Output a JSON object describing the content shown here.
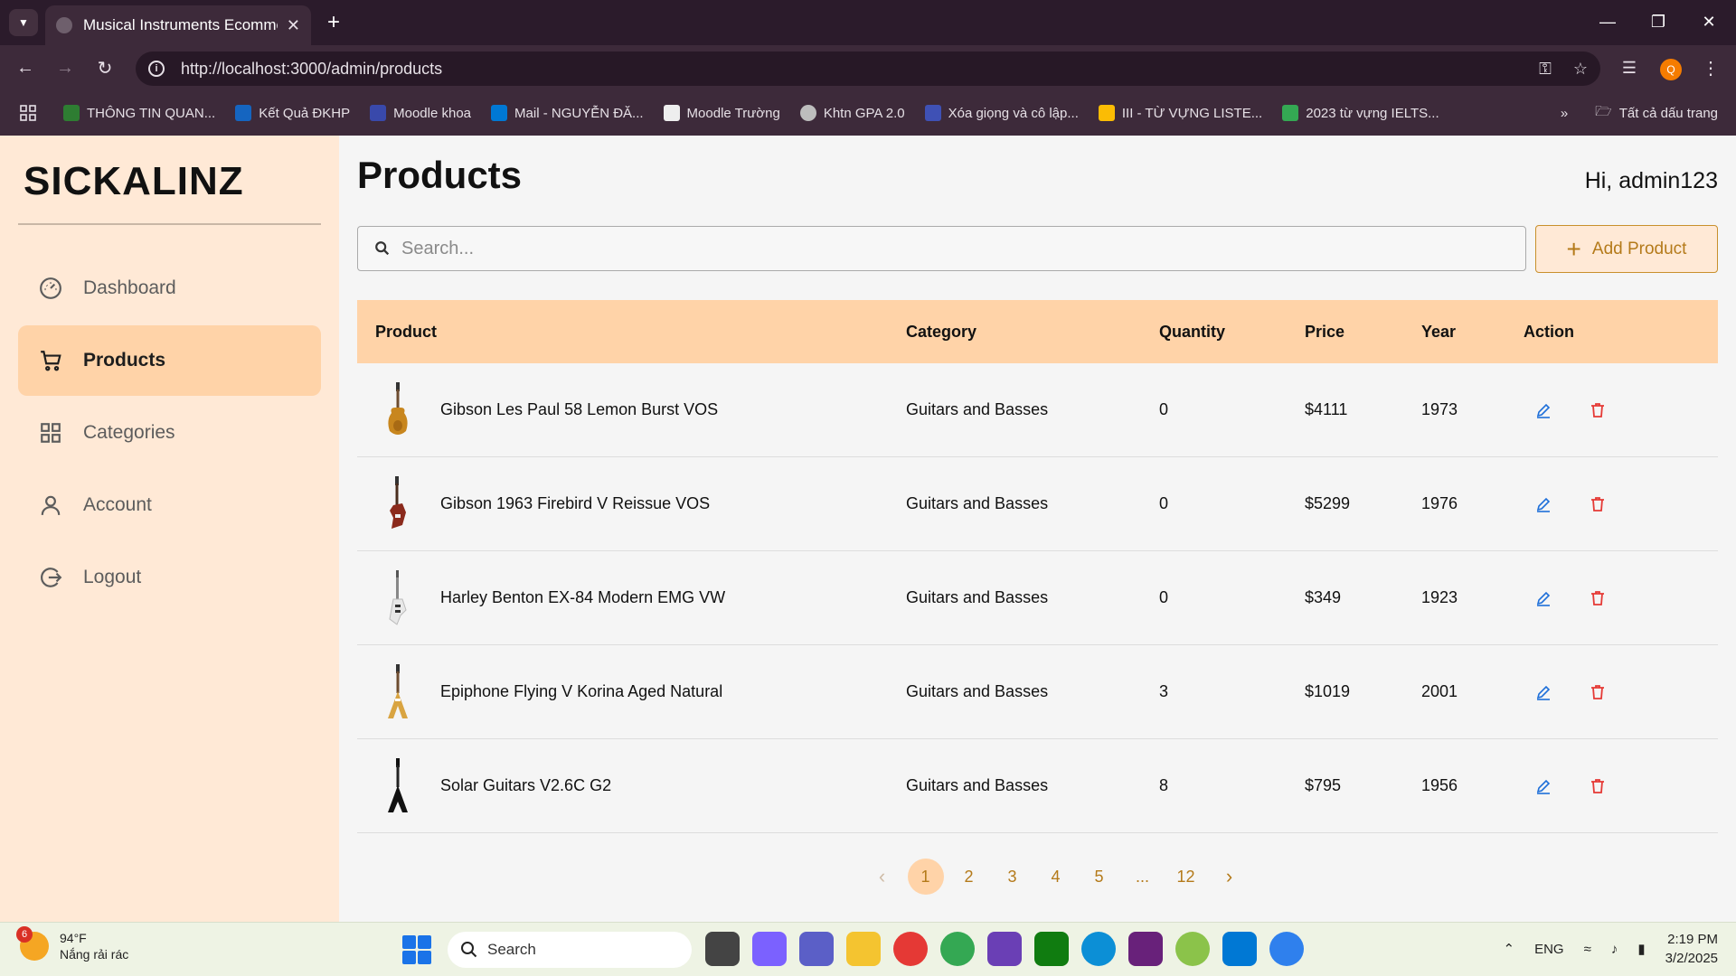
{
  "browser": {
    "tab_title": "Musical Instruments Ecommerce",
    "url": "http://localhost:3000/admin/products",
    "profile_initial": "Q",
    "bookmarks": [
      {
        "label": "THÔNG TIN QUAN...",
        "color": "#2e7d32"
      },
      {
        "label": "Kết Quả ĐKHP",
        "color": "#1565c0"
      },
      {
        "label": "Moodle khoa",
        "color": "#3949ab"
      },
      {
        "label": "Mail - NGUYỄN ĐĂ...",
        "color": "#0078d4"
      },
      {
        "label": "Moodle Trường",
        "color": "#eeeeee"
      },
      {
        "label": "Khtn GPA 2.0",
        "color": "#bdbdbd"
      },
      {
        "label": "Xóa giọng và cô lập...",
        "color": "#3f51b5"
      },
      {
        "label": "III - TỪ VỰNG LISTE...",
        "color": "#fbbc04"
      },
      {
        "label": "2023 từ vựng IELTS...",
        "color": "#34a853"
      }
    ],
    "all_bookmarks_label": "Tất cả dấu trang"
  },
  "sidebar": {
    "logo": "SICKALINZ",
    "items": [
      {
        "label": "Dashboard",
        "icon": "dashboard-icon"
      },
      {
        "label": "Products",
        "icon": "cart-icon",
        "active": true
      },
      {
        "label": "Categories",
        "icon": "grid-icon"
      },
      {
        "label": "Account",
        "icon": "user-icon"
      },
      {
        "label": "Logout",
        "icon": "logout-icon"
      }
    ]
  },
  "header": {
    "title": "Products",
    "greeting": "Hi, admin123"
  },
  "search": {
    "placeholder": "Search..."
  },
  "toolbar": {
    "add_label": "Add Product"
  },
  "table": {
    "columns": [
      "Product",
      "Category",
      "Quantity",
      "Price",
      "Year",
      "Action"
    ],
    "rows": [
      {
        "name": "Gibson Les Paul 58 Lemon Burst VOS",
        "category": "Guitars and Basses",
        "quantity": "0",
        "price": "$4111",
        "year": "1973",
        "thumb": "lespaul"
      },
      {
        "name": "Gibson 1963 Firebird V Reissue VOS",
        "category": "Guitars and Basses",
        "quantity": "0",
        "price": "$5299",
        "year": "1976",
        "thumb": "firebird"
      },
      {
        "name": "Harley Benton EX-84 Modern EMG VW",
        "category": "Guitars and Basses",
        "quantity": "0",
        "price": "$349",
        "year": "1923",
        "thumb": "explorer"
      },
      {
        "name": "Epiphone Flying V Korina Aged Natural",
        "category": "Guitars and Basses",
        "quantity": "3",
        "price": "$1019",
        "year": "2001",
        "thumb": "flyingv-natural"
      },
      {
        "name": "Solar Guitars V2.6C G2",
        "category": "Guitars and Basses",
        "quantity": "8",
        "price": "$795",
        "year": "1956",
        "thumb": "flyingv-black"
      }
    ]
  },
  "pagination": {
    "pages": [
      "1",
      "2",
      "3",
      "4",
      "5",
      "...",
      "12"
    ],
    "current": "1"
  },
  "taskbar": {
    "weather_temp": "94°F",
    "weather_desc": "Nắng rải rác",
    "weather_badge": "6",
    "search_label": "Search",
    "lang": "ENG",
    "time": "2:19 PM",
    "date": "3/2/2025"
  },
  "colors": {
    "sidebar_bg": "#ffe9d6",
    "accent": "#ffd3a8",
    "accent_text": "#b47a1a",
    "edit": "#1e6fd9",
    "delete": "#e53935"
  }
}
